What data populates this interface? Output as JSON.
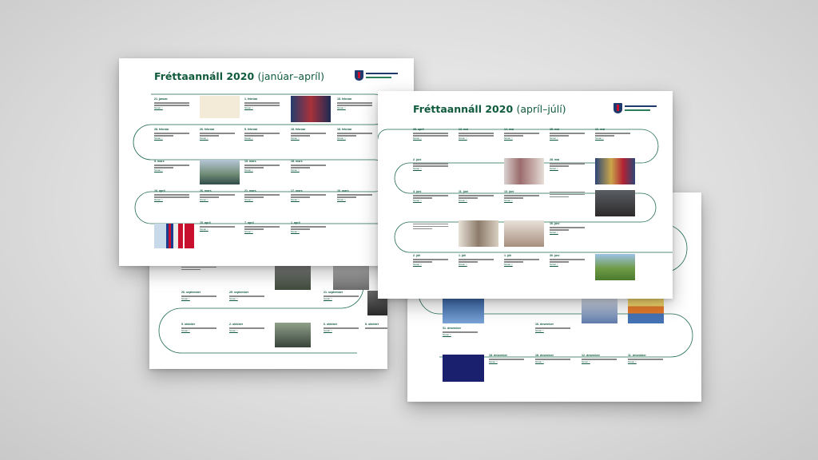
{
  "panels": {
    "a": {
      "title": "Fréttaannáll 2020",
      "subtitle": "(janúar–apríl)",
      "cards": [
        {
          "date": "21. janúar",
          "link": "Nánar >"
        },
        {
          "date": "1. febrúar",
          "link": "Nánar >"
        },
        {
          "date": "18. febrúar",
          "link": "Nánar >"
        },
        {
          "date": "28. febrúar",
          "link": "Nánar >"
        },
        {
          "date": "26. febrúar",
          "link": "Nánar >"
        },
        {
          "date": "5. febrúar",
          "link": "Nánar >"
        },
        {
          "date": "18. febrúar",
          "link": "Nánar >"
        },
        {
          "date": "18. febrúar",
          "link": "Nánar >"
        },
        {
          "date": "3. mars",
          "link": "Nánar >"
        },
        {
          "date": "13. mars",
          "link": "Nánar >"
        },
        {
          "date": "18. mars",
          "link": "Nánar >"
        },
        {
          "date": "16. apríl",
          "link": "Nánar >"
        },
        {
          "date": "26. mars",
          "link": "Nánar >"
        },
        {
          "date": "21. mars",
          "link": "Nánar >"
        },
        {
          "date": "17. mars",
          "link": "Nánar >"
        },
        {
          "date": "16. mars",
          "link": "Nánar >"
        },
        {
          "date": "15. apríl",
          "link": "Nánar >"
        },
        {
          "date": "7. apríl",
          "link": "Nánar >"
        },
        {
          "date": "1. apríl",
          "link": "Nánar >"
        }
      ]
    },
    "b": {
      "cards": [
        {
          "date": "26. september",
          "link": "Nánar >"
        },
        {
          "date": "29. september",
          "link": "Nánar >"
        },
        {
          "date": "21. september",
          "link": "Nánar >"
        },
        {
          "date": "5. október",
          "link": "Nánar >"
        },
        {
          "date": "2. október",
          "link": "Nánar >"
        },
        {
          "date": "6. október",
          "link": "Nánar >"
        },
        {
          "date": "8. október",
          "link": "Nánar >"
        }
      ]
    },
    "c": {
      "title": "Fréttaannáll 2020",
      "subtitle": "(apríl–júlí)",
      "cards": [
        {
          "date": "28. apríl",
          "link": "Nánar >"
        },
        {
          "date": "13. maí",
          "link": "Nánar >"
        },
        {
          "date": "14. maí",
          "link": "Nánar >"
        },
        {
          "date": "15. maí",
          "link": "Nánar >"
        },
        {
          "date": "16. maí",
          "link": "Nánar >"
        },
        {
          "date": "2. júní",
          "link": "Nánar >"
        },
        {
          "date": "28. maí",
          "link": "Nánar >"
        },
        {
          "date": "4. júní",
          "link": "Nánar >"
        },
        {
          "date": "11. júní",
          "link": "Nánar >"
        },
        {
          "date": "13. júní",
          "link": "Nánar >"
        },
        {
          "date": "16. júní",
          "link": "Nánar >"
        },
        {
          "date": "2. júlí",
          "link": "Nánar >"
        },
        {
          "date": "1. júlí",
          "link": "Nánar >"
        },
        {
          "date": "1. júlí",
          "link": "Nánar >"
        },
        {
          "date": "30. júní",
          "link": "Nánar >"
        }
      ]
    },
    "d": {
      "cards": [
        {
          "date": "31. desember",
          "link": "Nánar >"
        },
        {
          "date": "16. desember",
          "link": "Nánar >"
        },
        {
          "date": "12. desember",
          "link": "Nánar >"
        },
        {
          "date": "11. desember",
          "link": "Nánar >"
        },
        {
          "date": "18. desember",
          "link": "Nánar >"
        },
        {
          "date": "18. desember",
          "link": "Nánar >"
        }
      ]
    }
  },
  "colors": {
    "brand_green": "#0f5a3c",
    "track_green": "#1f6b4f",
    "crest_blue": "#1f3b6e",
    "crest_red": "#c8102e",
    "background": "#dcdcdc",
    "sheet": "#ffffff"
  },
  "icons": {
    "crest": "iceland-coat-of-arms-icon"
  }
}
